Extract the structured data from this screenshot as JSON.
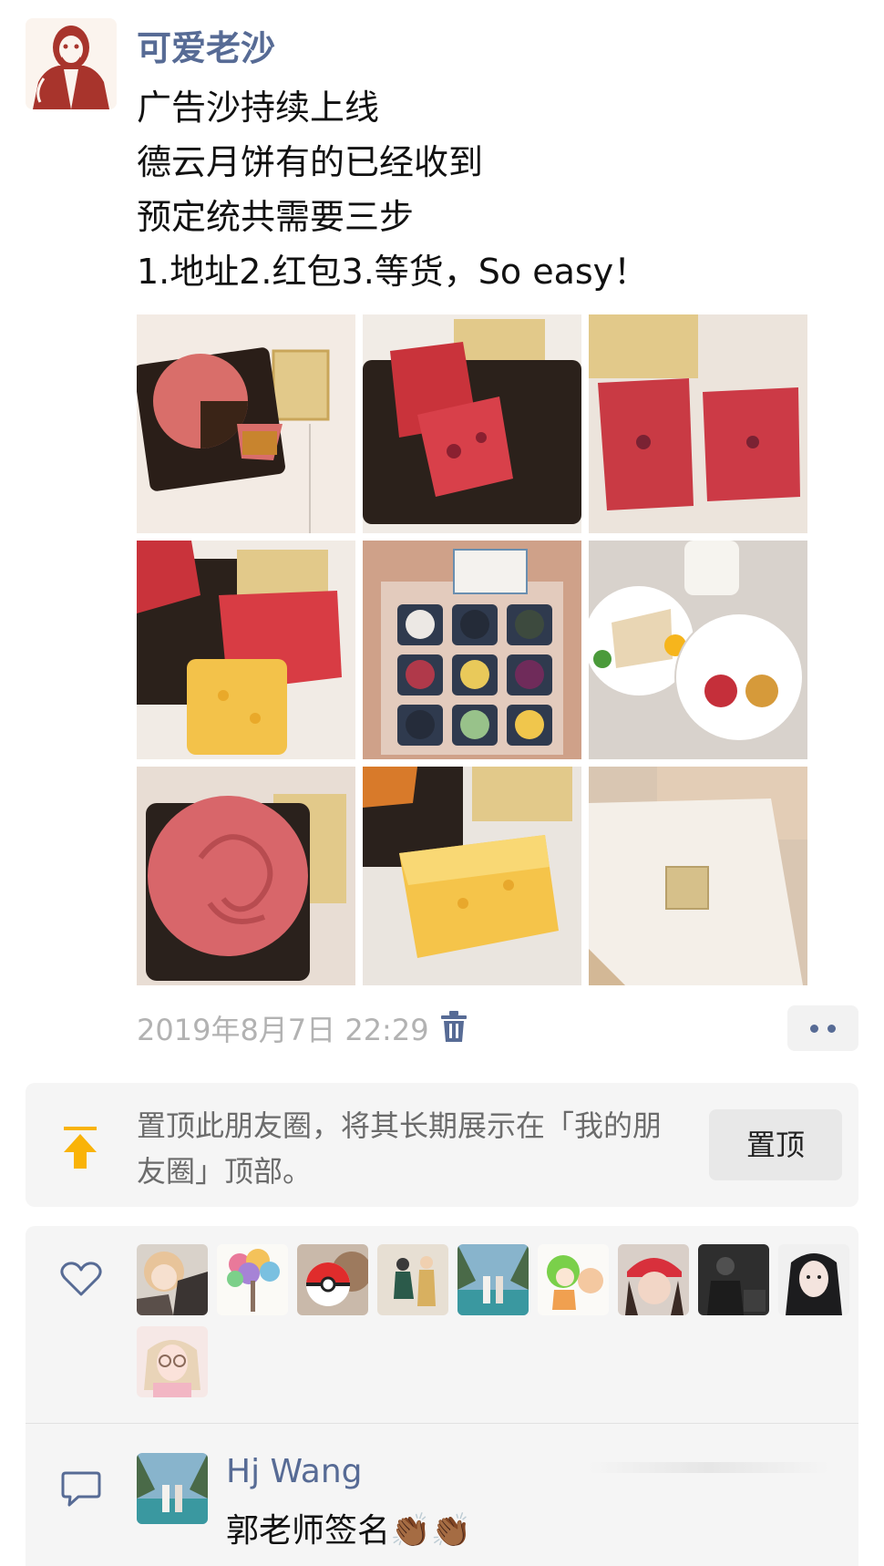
{
  "post": {
    "author": "可爱老沙",
    "avatar_icon": "guo-degang-portrait-icon",
    "text_lines": [
      "广告沙持续上线",
      "德云月饼有的已经收到",
      "预定统共需要三步",
      "1.地址2.红包3.等货，So easy！"
    ],
    "photos": [
      {
        "icon": "pink-mooncake-cut-photo-icon"
      },
      {
        "icon": "red-mooncake-broken-photo-icon"
      },
      {
        "icon": "red-mooncake-halves-photo-icon"
      },
      {
        "icon": "red-and-yellow-mooncake-photo-icon"
      },
      {
        "icon": "mooncake-gift-box-nine-photo-icon"
      },
      {
        "icon": "mooncake-plate-milk-photo-icon"
      },
      {
        "icon": "pink-rose-mooncake-photo-icon"
      },
      {
        "icon": "yellow-mooncake-slice-photo-icon"
      },
      {
        "icon": "cream-gift-box-photo-icon"
      }
    ],
    "timestamp": "2019年8月7日 22:29",
    "delete_icon": "trash-icon",
    "more_icon": "more-dots-icon"
  },
  "pin_panel": {
    "icon": "pin-to-top-icon",
    "text": "置顶此朋友圈，将其长期展示在「我的朋友圈」顶部。",
    "button_label": "置顶"
  },
  "likes": {
    "icon": "heart-icon",
    "avatars": [
      {
        "icon": "anime-girl-avatar-icon"
      },
      {
        "icon": "colorful-tree-drawing-avatar-icon"
      },
      {
        "icon": "pokeball-avatar-icon"
      },
      {
        "icon": "cartoon-figures-avatar-icon"
      },
      {
        "icon": "couple-lake-avatar-icon"
      },
      {
        "icon": "green-hair-cartoon-avatar-icon"
      },
      {
        "icon": "girl-red-hat-avatar-icon"
      },
      {
        "icon": "dark-photo-avatar-icon"
      },
      {
        "icon": "girl-long-hair-avatar-icon"
      },
      {
        "icon": "girl-glasses-avatar-icon"
      }
    ]
  },
  "comments": {
    "icon": "comment-bubble-icon",
    "items": [
      {
        "name": "Hj Wang",
        "avatar_icon": "couple-lake-avatar-icon",
        "text": "郭老师签名👏🏾👏🏾"
      }
    ]
  },
  "colors": {
    "link_blue": "#576b95",
    "panel_bg": "#f5f5f5",
    "pin_orange": "#f9b308",
    "timestamp_gray": "#b2b2b2"
  }
}
